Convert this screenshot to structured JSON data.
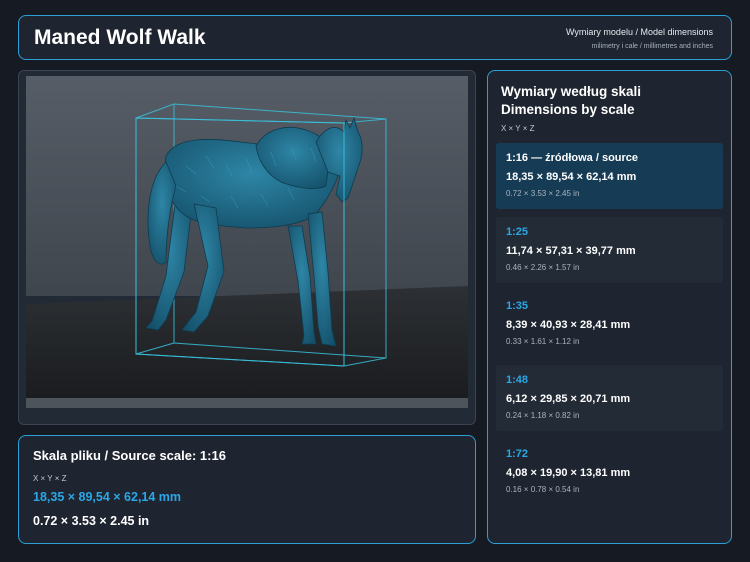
{
  "header": {
    "title": "Maned Wolf Walk",
    "subtitle": "Wymiary modelu / Model dimensions",
    "units_note": "milimetry i cale / millimetres and inches"
  },
  "viewer": {
    "model_icon": "wolf-model-icon"
  },
  "source": {
    "title": "Skala pliku / Source scale: 1:16",
    "axes": "X × Y × Z",
    "mm": "18,35 × 89,54 × 62,14 mm",
    "inches": "0.72 × 3.53 × 2.45 in"
  },
  "scales_panel": {
    "title": "Wymiary według skali Dimensions by scale",
    "axes": "X × Y × Z",
    "items": [
      {
        "label": "1:16  —  źródłowa / source",
        "mm": "18,35 × 89,54 × 62,14 mm",
        "inches": "0.72 × 3.53 × 2.45 in"
      },
      {
        "label": "1:25",
        "mm": "11,74 × 57,31 × 39,77 mm",
        "inches": "0.46 × 2.26 × 1.57 in"
      },
      {
        "label": "1:35",
        "mm": "8,39 × 40,93 × 28,41 mm",
        "inches": "0.33 × 1.61 × 1.12 in"
      },
      {
        "label": "1:48",
        "mm": "6,12 × 29,85 × 20,71 mm",
        "inches": "0.24 × 1.18 × 0.82 in"
      },
      {
        "label": "1:72",
        "mm": "4,08 × 19,90 × 13,81 mm",
        "inches": "0.16 × 0.78 × 0.54 in"
      }
    ]
  },
  "colors": {
    "accent": "#2ba7e6",
    "panel_bg": "#1e2530",
    "page_bg": "#161b23",
    "model": "#1f6a86",
    "bbox_line": "#39c2dd"
  }
}
